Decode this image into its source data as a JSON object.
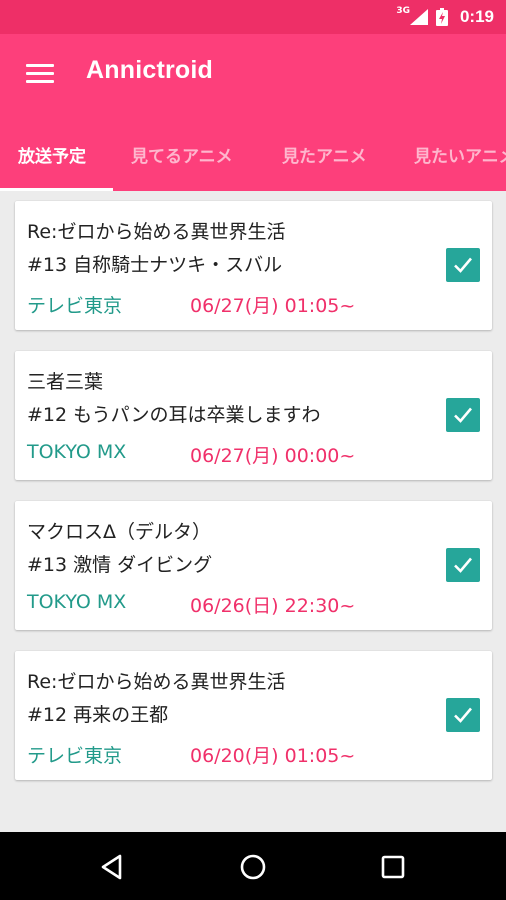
{
  "status_bar": {
    "network": "3G",
    "time": "0:19",
    "signal_icon": "cell-signal-icon",
    "battery_icon": "battery-charging-icon"
  },
  "app_bar": {
    "menu_icon": "hamburger-menu-icon",
    "title": "Annictroid",
    "background": "#fd3f7b"
  },
  "tabs": [
    {
      "label": "放送予定",
      "active": true
    },
    {
      "label": "見てるアニメ",
      "active": false
    },
    {
      "label": "見たアニメ",
      "active": false
    },
    {
      "label": "見たいアニメ",
      "active": false
    }
  ],
  "programs": [
    {
      "title": "Re:ゼロから始める異世界生活",
      "episode": "#13 自称騎士ナツキ・スバル",
      "channel": "テレビ東京",
      "datetime": "06/27(月) 01:05~",
      "checked": true
    },
    {
      "title": "三者三葉",
      "episode": "#12 もうパンの耳は卒業しますわ",
      "channel": "TOKYO MX",
      "datetime": "06/27(月) 00:00~",
      "checked": true
    },
    {
      "title": "マクロスΔ（デルタ）",
      "episode": "#13 激情 ダイビング",
      "channel": "TOKYO MX",
      "datetime": "06/26(日) 22:30~",
      "checked": true
    },
    {
      "title": "Re:ゼロから始める異世界生活",
      "episode": "#12 再来の王都",
      "channel": "テレビ東京",
      "datetime": "06/20(月) 01:05~",
      "checked": true
    }
  ],
  "colors": {
    "status_bar": "#ee2f67",
    "accent": "#fd3f7b",
    "channel": "#229a8a",
    "datetime": "#f0306a",
    "check": "#26a69a"
  },
  "nav_bar": {
    "back_icon": "back-triangle-icon",
    "home_icon": "home-circle-icon",
    "recent_icon": "recent-apps-square-icon"
  }
}
